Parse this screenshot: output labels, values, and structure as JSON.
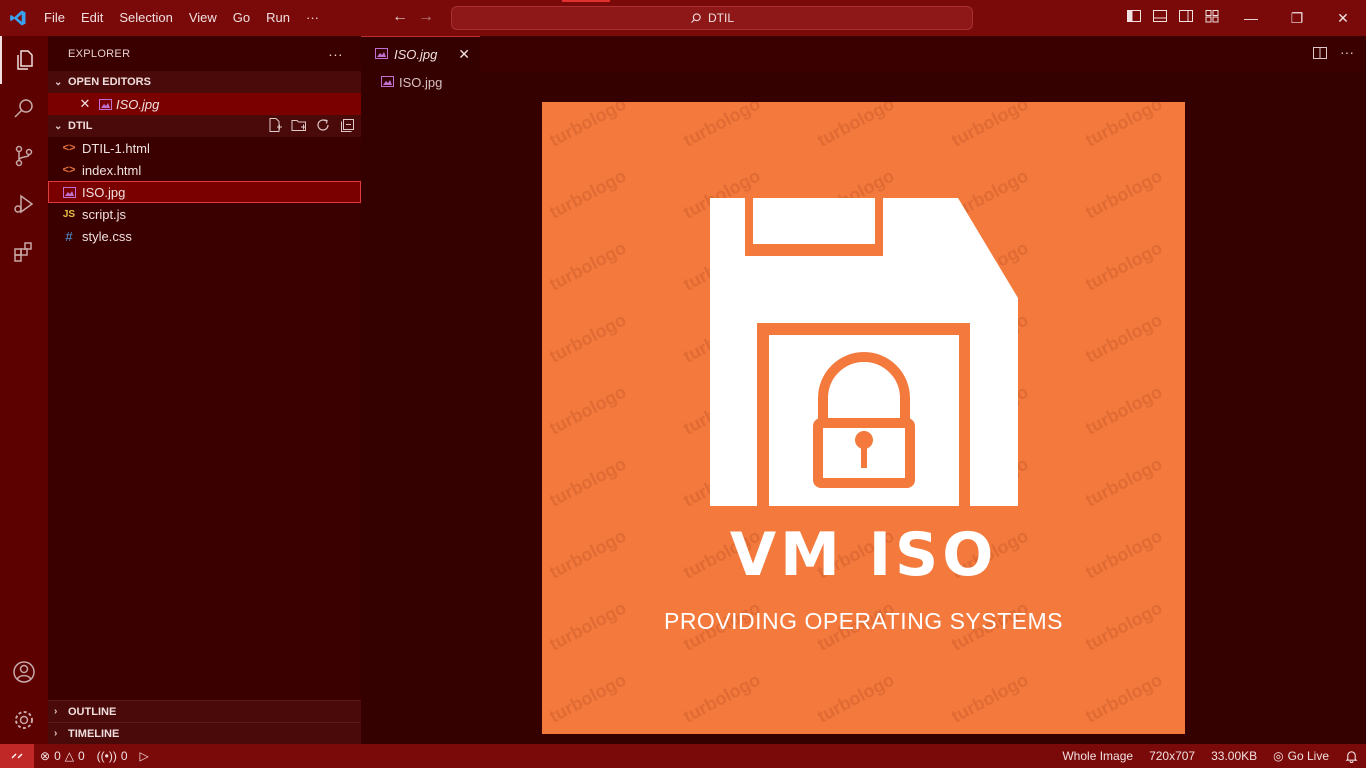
{
  "menu": [
    "File",
    "Edit",
    "Selection",
    "View",
    "Go",
    "Run",
    "···"
  ],
  "command_center": "DTIL",
  "explorer": {
    "title": "EXPLORER",
    "more": "···",
    "open_editors_label": "OPEN EDITORS",
    "open_editor_file": "ISO.jpg",
    "folder_label": "DTIL",
    "files": [
      {
        "name": "DTIL-1.html",
        "icon": "<>"
      },
      {
        "name": "index.html",
        "icon": "<>"
      },
      {
        "name": "ISO.jpg",
        "icon": "img"
      },
      {
        "name": "script.js",
        "icon": "JS"
      },
      {
        "name": "style.css",
        "icon": "#"
      }
    ],
    "outline_label": "OUTLINE",
    "timeline_label": "TIMELINE"
  },
  "editor": {
    "tab_label": "ISO.jpg",
    "breadcrumb": "ISO.jpg",
    "image": {
      "title": "VM ISO",
      "subtitle": "PROVIDING OPERATING SYSTEMS",
      "watermark": "turbologo"
    }
  },
  "status": {
    "errors": "0",
    "warnings": "0",
    "ports": "0",
    "whole_image": "Whole Image",
    "dimensions": "720x707",
    "size": "33.00KB",
    "go_live": "Go Live"
  },
  "colors": {
    "titlebar": "#7a0a0a",
    "sidebar": "#3a0000",
    "editor_bg": "#350000",
    "image_bg": "#f37a3c",
    "accent": "#e03030"
  }
}
